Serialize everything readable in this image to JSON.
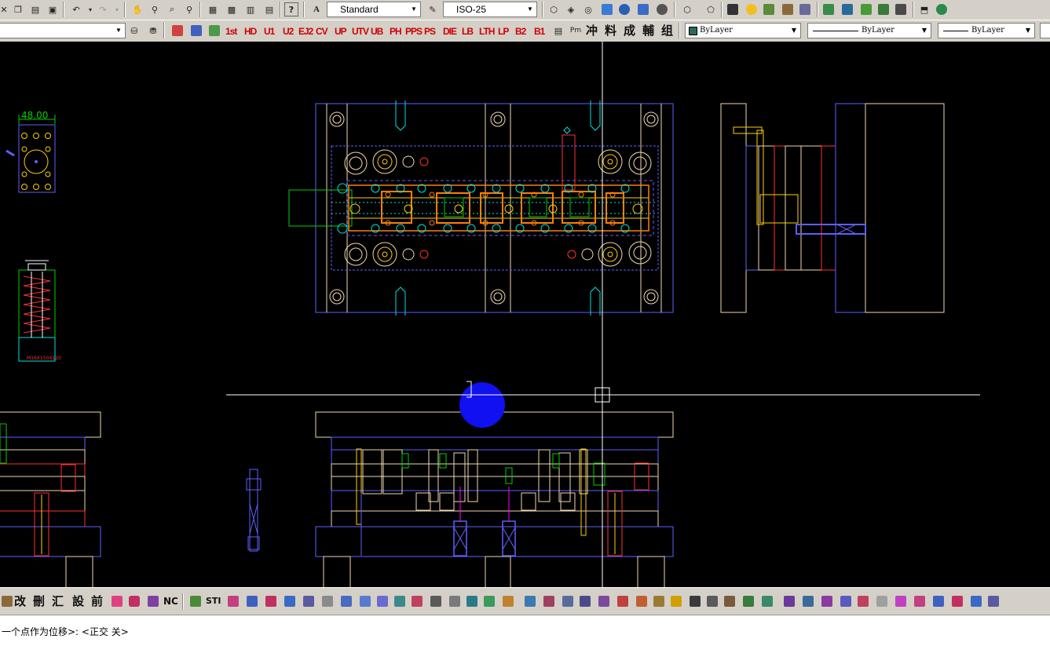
{
  "toolbar_top": {
    "text_style": "Standard",
    "dim_style": "ISO-25"
  },
  "toolbar_layer": {
    "color": "ByLayer",
    "linetype": "ByLayer",
    "lineweight": "ByLayer",
    "custom_commands": [
      "1st",
      "HD",
      "U1",
      "U2",
      "EJ2",
      "CV",
      "UP",
      "UTV",
      "UB",
      "PH",
      "PPS",
      "PS",
      "DIE",
      "LB",
      "LTH",
      "LP",
      "B2",
      "B1"
    ],
    "chinese_commands": [
      "冲",
      "料",
      "成",
      "輔",
      "组"
    ]
  },
  "toolbar_bottom": {
    "chinese_commands": [
      "改",
      "刪",
      "汇",
      "設",
      "前"
    ],
    "text_commands": [
      "NC",
      "STI"
    ]
  },
  "drawing": {
    "dimension_text": "48.00",
    "part_label": "M16X150X120"
  },
  "command_line": {
    "text": "一个点作为位移>: <正交 关>"
  },
  "colors": {
    "canvas": "#000000",
    "plate": "#f0d8b0",
    "blue_outline": "#5f5fff",
    "red": "#ff3030",
    "green": "#00d000",
    "yellow": "#ffd000",
    "orange": "#ff8000",
    "cyan": "#00e0e0",
    "crosshair": "#ffffff"
  }
}
